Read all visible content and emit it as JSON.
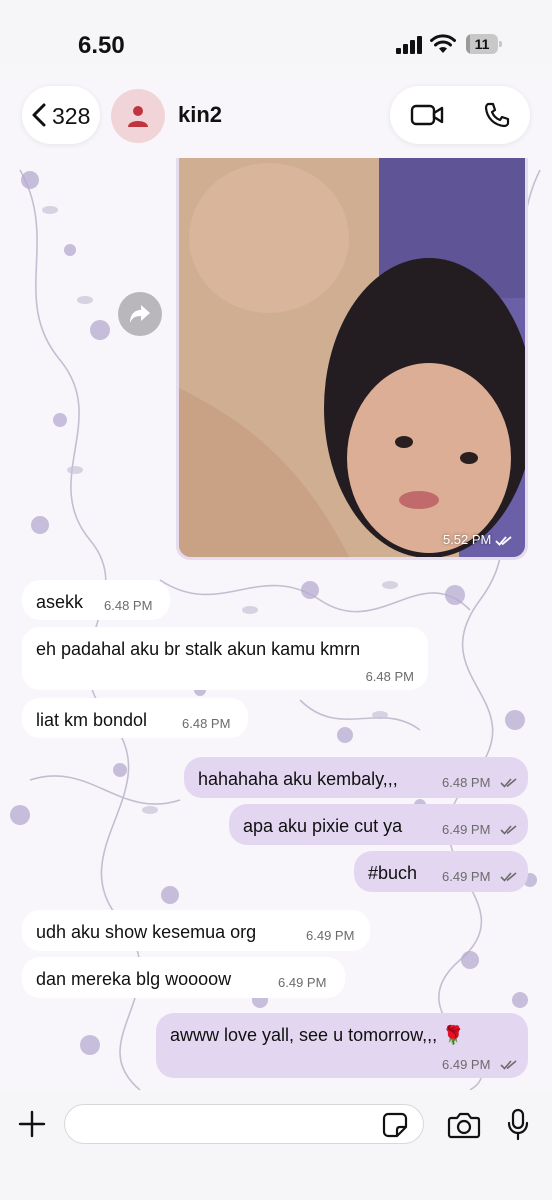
{
  "status_bar": {
    "time": "6.50",
    "battery_level": "11",
    "battery_fraction": 0.11
  },
  "header": {
    "back_count": "328",
    "contact_name": "kin2"
  },
  "photo_message": {
    "time": "5.52 PM",
    "status": "read"
  },
  "messages": [
    {
      "direction": "in",
      "text": "asekk",
      "time": "6.48 PM"
    },
    {
      "direction": "in",
      "text": "eh padahal aku br stalk akun kamu kmrn",
      "time": "6.48 PM"
    },
    {
      "direction": "in",
      "text": "liat km bondol",
      "time": "6.48 PM"
    },
    {
      "direction": "out",
      "text": "hahahaha aku kembaly,,,",
      "time": "6.48 PM",
      "status": "read"
    },
    {
      "direction": "out",
      "text": "apa aku pixie cut ya",
      "time": "6.49 PM",
      "status": "read"
    },
    {
      "direction": "out",
      "text": "#buch",
      "time": "6.49 PM",
      "status": "read"
    },
    {
      "direction": "in",
      "text": "udh aku show kesemua org",
      "time": "6.49 PM"
    },
    {
      "direction": "in",
      "text": "dan mereka blg woooow",
      "time": "6.49 PM"
    },
    {
      "direction": "out",
      "text": "awww love yall, see u tomorrow,,, 🌹",
      "time": "6.49 PM",
      "status": "read"
    }
  ],
  "compose": {
    "placeholder": ""
  },
  "icons": {
    "back": "chevron-left-icon",
    "avatar": "person-icon",
    "video": "video-camera-icon",
    "phone": "phone-icon",
    "forward": "forward-icon",
    "attach": "plus-icon",
    "sticker": "sticker-icon",
    "camera": "camera-icon",
    "mic": "microphone-icon"
  },
  "colors": {
    "incoming": "#ffffff",
    "outgoing": "#e3d6f1",
    "avatar_bg": "#f1d4d8",
    "avatar_fg": "#c0343f"
  }
}
